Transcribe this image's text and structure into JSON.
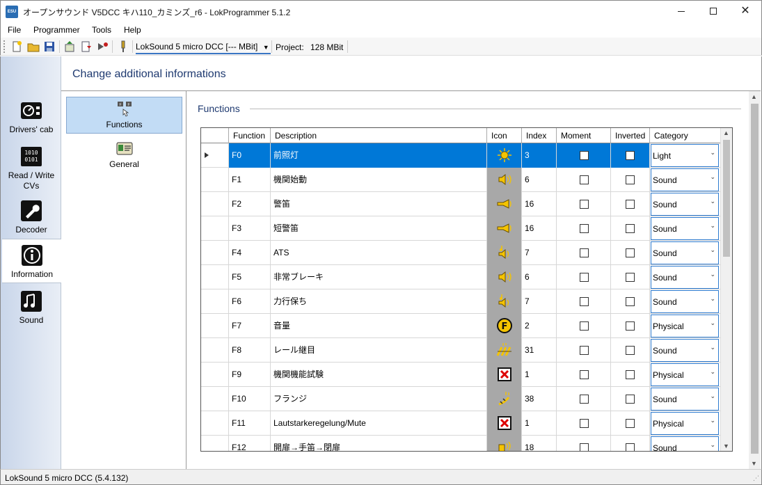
{
  "window": {
    "title": "オープンサウンド V5DCC キハ110_カミンズ_r6 - LokProgrammer 5.1.2",
    "app_icon_text": "ESU"
  },
  "menu": {
    "file": "File",
    "programmer": "Programmer",
    "tools": "Tools",
    "help": "Help"
  },
  "toolbar": {
    "device": "LokSound 5 micro DCC [--- MBit]",
    "project_label": "Project:",
    "project_value": "128 MBit"
  },
  "leftnav": {
    "items": [
      {
        "label": "Drivers' cab",
        "icon": "drivers-cab-icon"
      },
      {
        "label": "Read / Write CVs",
        "icon": "read-write-cvs-icon"
      },
      {
        "label": "Decoder",
        "icon": "wrench-icon"
      },
      {
        "label": "Information",
        "icon": "info-icon"
      },
      {
        "label": "Sound",
        "icon": "music-note-icon"
      }
    ],
    "active": "Information"
  },
  "header": {
    "title": "Change additional informations"
  },
  "subnav": {
    "items": [
      {
        "label": "Functions",
        "icon": "function-keys-icon"
      },
      {
        "label": "General",
        "icon": "id-card-icon"
      }
    ],
    "active": "Functions"
  },
  "section": {
    "title": "Functions"
  },
  "grid": {
    "columns": [
      "Function",
      "Description",
      "Icon",
      "Index",
      "Moment",
      "Inverted",
      "Category"
    ],
    "rows": [
      {
        "function": "F0",
        "description": "前照灯",
        "icon": "light-icon",
        "index": "3",
        "moment": false,
        "inverted": false,
        "category": "Light",
        "selected": true
      },
      {
        "function": "F1",
        "description": "機関始動",
        "icon": "sound-speaker-icon",
        "index": "6",
        "moment": false,
        "inverted": false,
        "category": "Sound"
      },
      {
        "function": "F2",
        "description": "警笛",
        "icon": "horn-icon",
        "index": "16",
        "moment": false,
        "inverted": false,
        "category": "Sound"
      },
      {
        "function": "F3",
        "description": "短警笛",
        "icon": "horn-icon",
        "index": "16",
        "moment": false,
        "inverted": false,
        "category": "Sound"
      },
      {
        "function": "F4",
        "description": "ATS",
        "icon": "note-speaker-icon",
        "index": "7",
        "moment": false,
        "inverted": false,
        "category": "Sound"
      },
      {
        "function": "F5",
        "description": "非常ブレーキ",
        "icon": "sound-speaker-icon",
        "index": "6",
        "moment": false,
        "inverted": false,
        "category": "Sound"
      },
      {
        "function": "F6",
        "description": "力行保ち",
        "icon": "note-speaker-icon",
        "index": "7",
        "moment": false,
        "inverted": false,
        "category": "Sound"
      },
      {
        "function": "F7",
        "description": "音量",
        "icon": "f-circle-icon",
        "index": "2",
        "moment": false,
        "inverted": false,
        "category": "Physical"
      },
      {
        "function": "F8",
        "description": "レール継目",
        "icon": "rail-joint-icon",
        "index": "31",
        "moment": false,
        "inverted": false,
        "category": "Sound"
      },
      {
        "function": "F9",
        "description": "機関機能試験",
        "icon": "red-x-icon",
        "index": "1",
        "moment": false,
        "inverted": false,
        "category": "Physical"
      },
      {
        "function": "F10",
        "description": "フランジ",
        "icon": "flange-icon",
        "index": "38",
        "moment": false,
        "inverted": false,
        "category": "Sound"
      },
      {
        "function": "F11",
        "description": "Lautstarkeregelung/Mute",
        "icon": "red-x-icon",
        "index": "1",
        "moment": false,
        "inverted": false,
        "category": "Physical"
      },
      {
        "function": "F12",
        "description": "開扉→手笛→閉扉",
        "icon": "door-sound-icon",
        "index": "18",
        "moment": false,
        "inverted": false,
        "category": "Sound"
      }
    ]
  },
  "statusbar": {
    "text": "LokSound 5 micro DCC (5.4.132)"
  },
  "colors": {
    "selection": "#0078d7",
    "header_text": "#1f3a70",
    "icon_yellow": "#f5c400",
    "nav_gradient_start": "#c9d6ea"
  }
}
